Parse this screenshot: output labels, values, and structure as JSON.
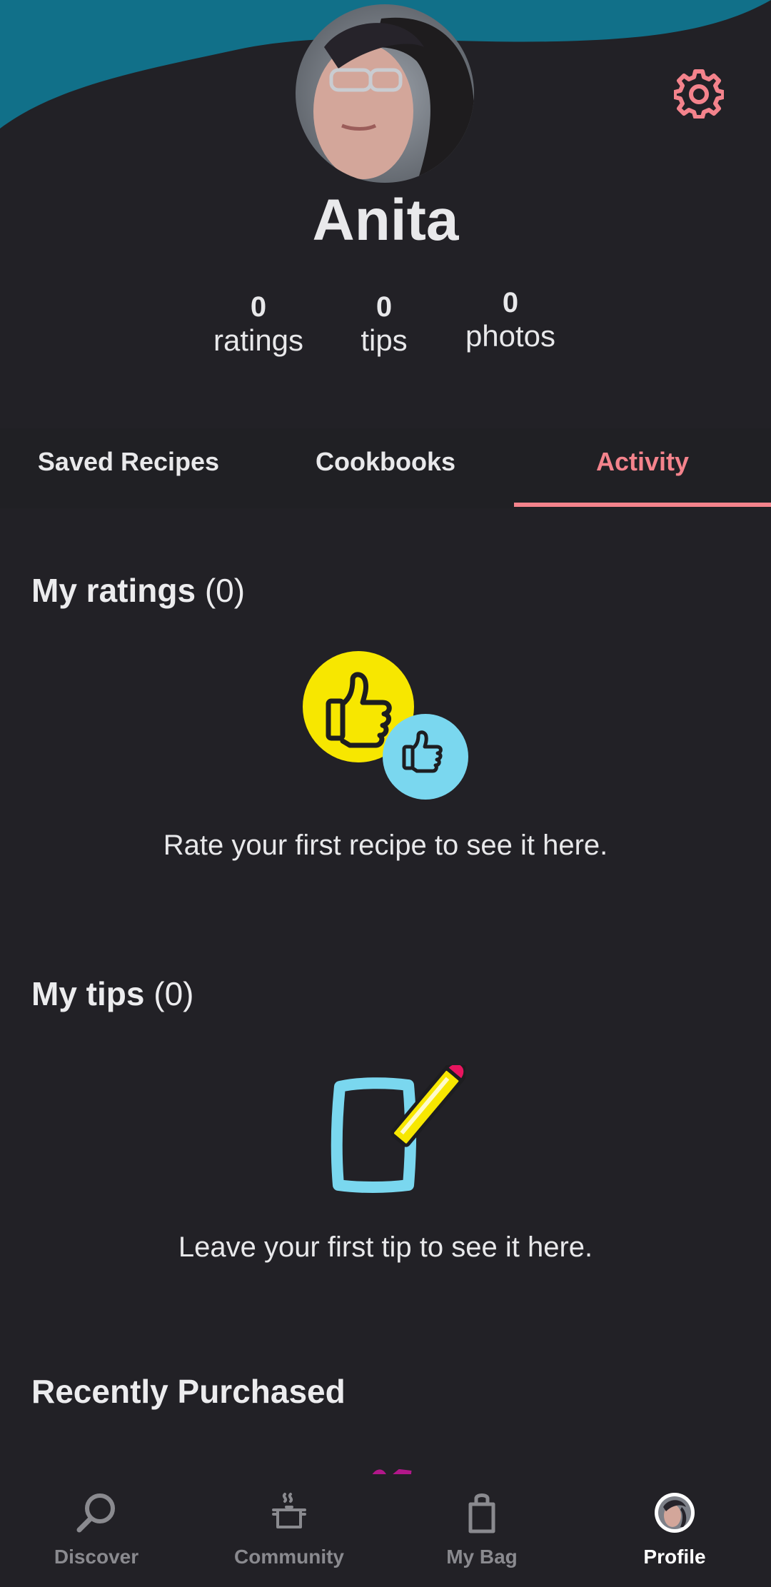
{
  "profile": {
    "name": "Anita",
    "stats": [
      {
        "value": "0",
        "label": "ratings"
      },
      {
        "value": "0",
        "label": "tips"
      },
      {
        "value": "0",
        "label": "photos"
      }
    ]
  },
  "tabs": [
    {
      "label": "Saved Recipes",
      "active": false
    },
    {
      "label": "Cookbooks",
      "active": false
    },
    {
      "label": "Activity",
      "active": true
    }
  ],
  "ratings": {
    "title": "My ratings",
    "count": "(0)",
    "empty_text": "Rate your first recipe to see it here."
  },
  "tips": {
    "title": "My tips",
    "count": "(0)",
    "empty_text": "Leave your first tip to see it here."
  },
  "recent": {
    "title": "Recently Purchased"
  },
  "nav": [
    {
      "label": "Discover",
      "icon": "search-icon"
    },
    {
      "label": "Community",
      "icon": "cooking-pot-icon"
    },
    {
      "label": "My Bag",
      "icon": "shopping-bag-icon"
    },
    {
      "label": "Profile",
      "icon": "avatar-icon",
      "active": true
    }
  ],
  "colors": {
    "background": "#222126",
    "header": "#117089",
    "accent": "#f4838c",
    "yellow": "#f7e700",
    "cyan": "#7ad7ef"
  }
}
